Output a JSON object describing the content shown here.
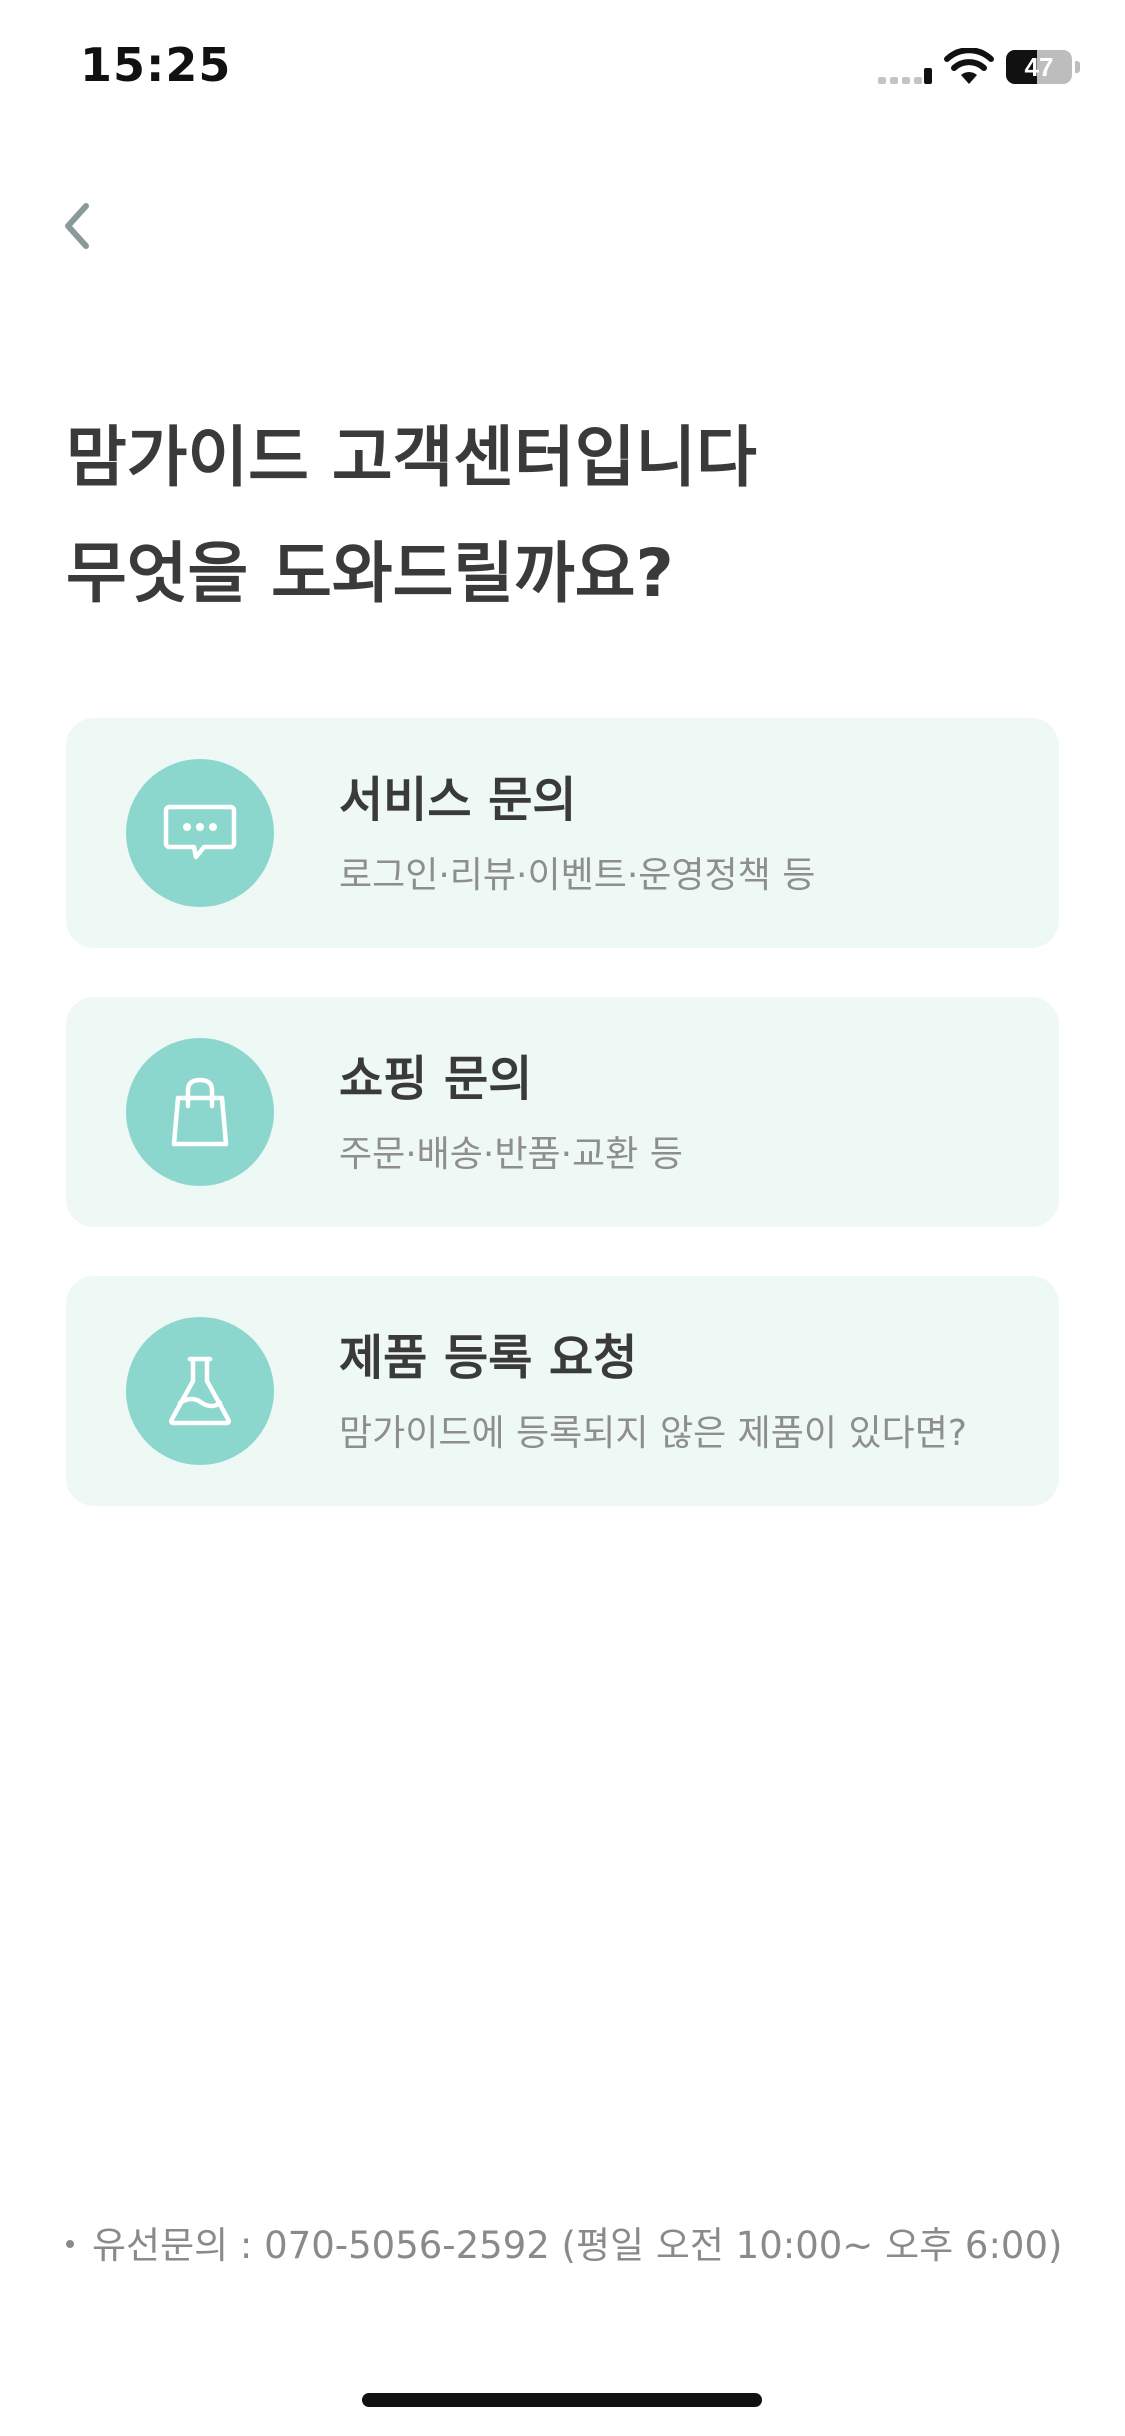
{
  "status_bar": {
    "time": "15:25",
    "battery_level": "47",
    "battery_fraction": 0.47
  },
  "header": {
    "back_icon": "chevron-left-icon"
  },
  "title": {
    "line1": "맘가이드 고객센터입니다",
    "line2": "무엇을 도와드릴까요?"
  },
  "menu": {
    "items": [
      {
        "icon": "chat-bubble-icon",
        "title": "서비스 문의",
        "description": "로그인·리뷰·이벤트·운영정책 등"
      },
      {
        "icon": "shopping-bag-icon",
        "title": "쇼핑 문의",
        "description": "주문·배송·반품·교환 등"
      },
      {
        "icon": "flask-icon",
        "title": "제품 등록 요청",
        "description": "맘가이드에 등록되지 않은 제품이 있다면?"
      }
    ]
  },
  "footer": {
    "phone_note": "유선문의 : 070-5056-2592 (평일 오전 10:00~ 오후 6:00)"
  },
  "colors": {
    "card_background": "#eef8f4",
    "icon_circle": "#8cd7cd",
    "title_text": "#3a3a3a",
    "secondary_text": "#8e8e8e"
  }
}
